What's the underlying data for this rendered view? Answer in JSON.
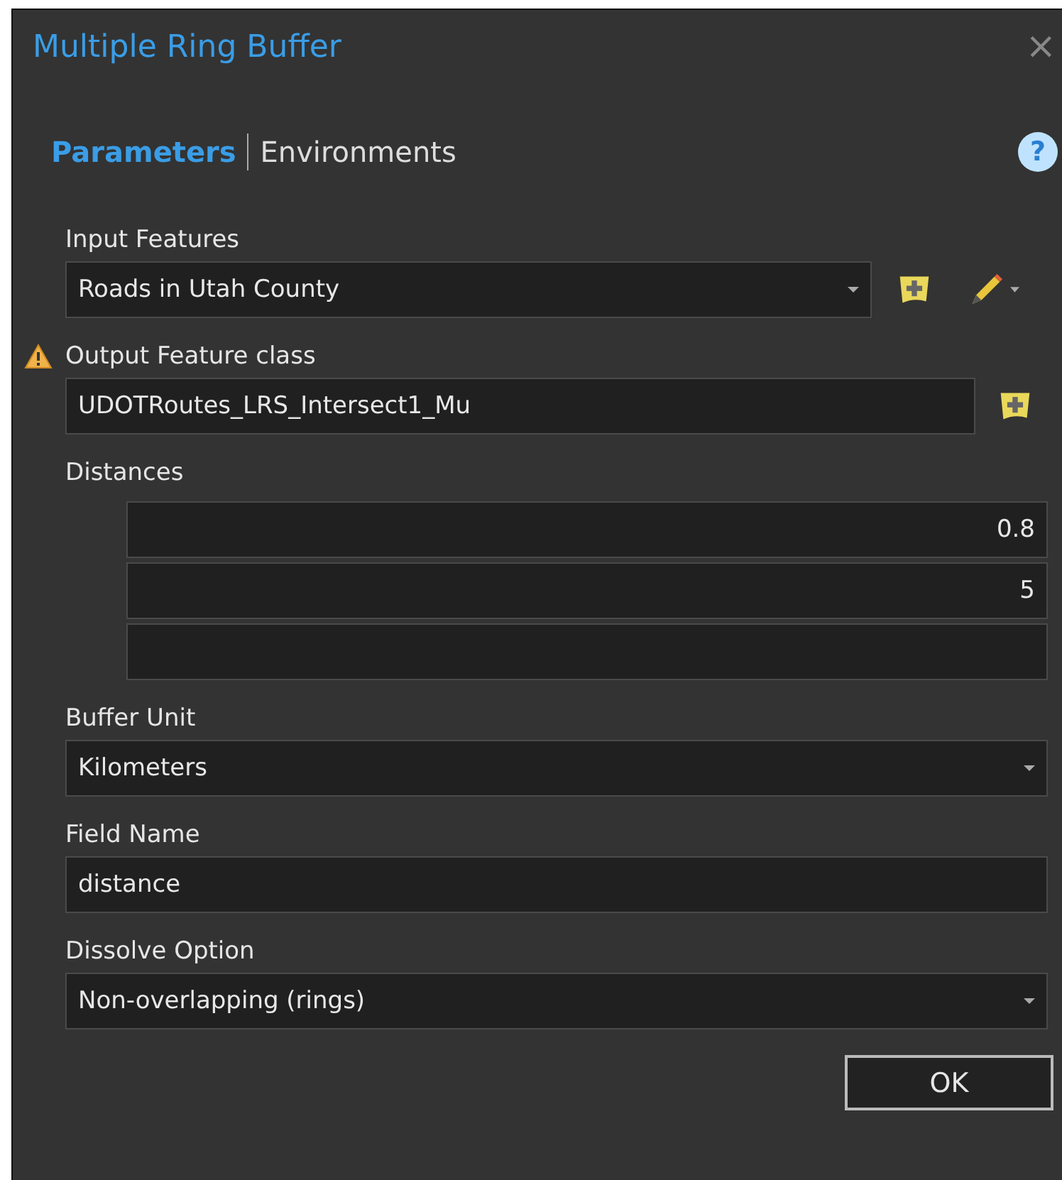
{
  "window": {
    "title": "Multiple Ring Buffer",
    "close": "×"
  },
  "tabs": [
    {
      "label": "Parameters",
      "selected": true
    },
    {
      "label": "Environments",
      "selected": false
    }
  ],
  "help": "?",
  "parameters": [
    {
      "kind": "layer-dropdown",
      "label": "Input Features",
      "value": "Roads in Utah County",
      "warning": false
    },
    {
      "kind": "output-text",
      "label": "Output Feature class",
      "value": "UDOTRoutes_LRS_Intersect1_Mu",
      "warning": true
    },
    {
      "kind": "list",
      "label": "Distances",
      "values": [
        "0.8",
        "5"
      ],
      "blank_row": true,
      "warning": false
    },
    {
      "kind": "dropdown",
      "label": "Buffer Unit",
      "value": "Kilometers",
      "warning": false
    },
    {
      "kind": "text",
      "label": "Field Name",
      "value": "distance",
      "warning": false
    },
    {
      "kind": "dropdown",
      "label": "Dissolve Option",
      "value": "Non-overlapping (rings)",
      "warning": false
    }
  ],
  "buttons": [
    "OK"
  ]
}
